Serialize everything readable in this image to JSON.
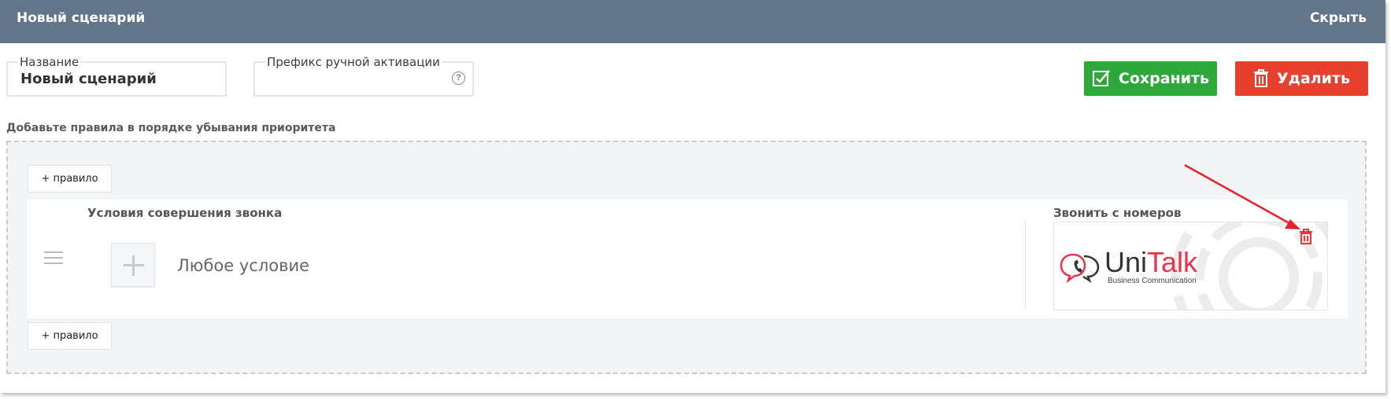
{
  "header": {
    "title": "Новый сценарий",
    "hide_label": "Скрыть"
  },
  "form": {
    "name_label": "Название",
    "name_value": "Новый сценарий",
    "prefix_label": "Префикс ручной активации",
    "prefix_value": "",
    "prefix_help": "?"
  },
  "actions": {
    "save_label": "Сохранить",
    "delete_label": "Удалить"
  },
  "hint": "Добавьте правила в порядке убывания приоритета",
  "rules": {
    "add_rule_label": "+ правило",
    "items": [
      {
        "conditions_title": "Условия совершения звонка",
        "condition": "Любое условие",
        "numbers_title": "Звонить с номеров",
        "number_card": {
          "brand_part1": "Uni",
          "brand_part2": "Talk",
          "tagline": "Business Communication"
        }
      }
    ]
  },
  "colors": {
    "header_bg": "#637589",
    "save": "#2ea83a",
    "delete": "#e8402f",
    "brand_red": "#e8344a",
    "annotation_arrow": "#e8202a"
  },
  "icons": [
    "checkbox-check-icon",
    "trash-icon",
    "help-icon",
    "drag-handle-icon",
    "plus-icon",
    "phone-chat-icon"
  ]
}
